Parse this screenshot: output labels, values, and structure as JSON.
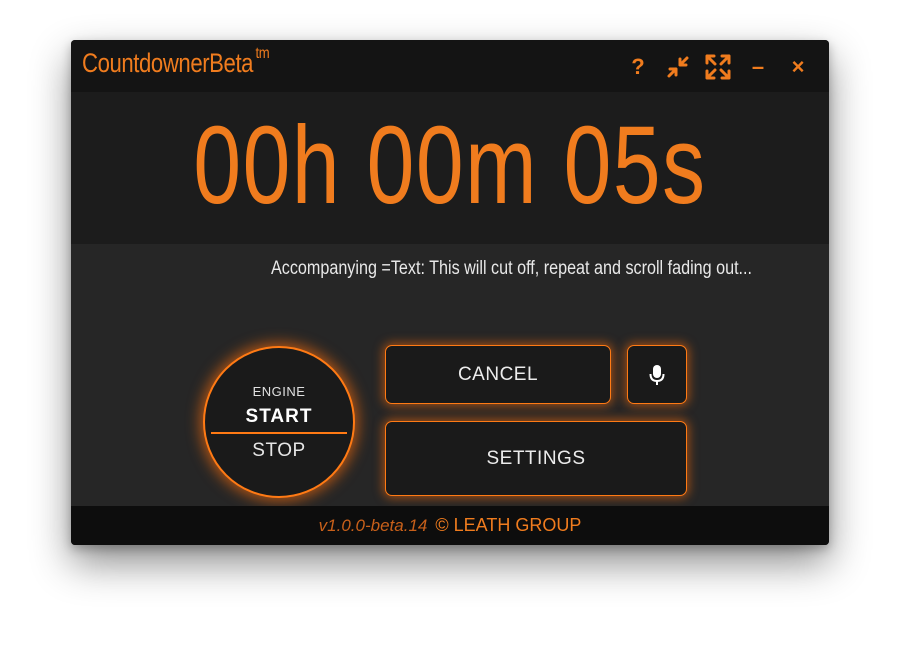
{
  "app": {
    "title": "CountdownerBeta",
    "title_suffix": "tm"
  },
  "titlebar": {
    "help_icon": "?",
    "minimize_label": "–",
    "close_label": "×"
  },
  "timer": {
    "display": "00h 00m 05s"
  },
  "accompanying_text": "Accompanying =Text: This will cut off, repeat and scroll fading out...",
  "engine": {
    "label": "ENGINE",
    "start_label": "START",
    "stop_label": "STOP"
  },
  "buttons": {
    "cancel_label": "CANCEL",
    "settings_label": "SETTINGS",
    "mic_icon": "microphone-icon"
  },
  "footer": {
    "version": "v1.0.0-beta.14",
    "copyright": "© LEATH GROUP"
  },
  "colors": {
    "accent": "#f07c1e",
    "background": "#262626",
    "panel": "#1a1a1a"
  }
}
